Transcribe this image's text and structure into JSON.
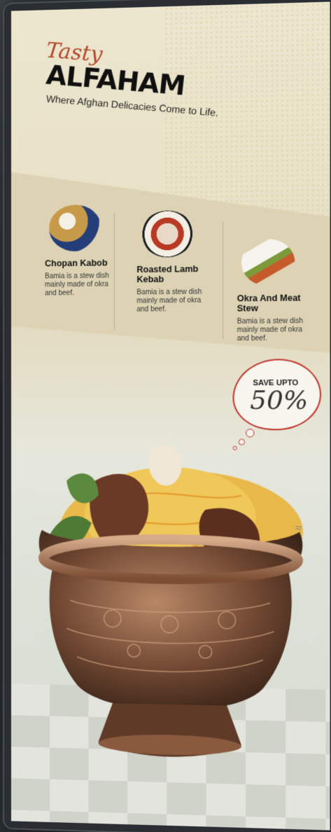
{
  "header": {
    "script": "Tasty",
    "brand": "ALFAHAM",
    "tagline": "Where Afghan Delicacies Come to Life."
  },
  "menu": {
    "items": [
      {
        "name": "Chopan Kabob",
        "description": "Bamia is a stew dish mainly made of okra and beef.",
        "icon": "kabob-plate-icon"
      },
      {
        "name": "Roasted Lamb Kebab",
        "description": "Bamia is a stew dish mainly made of okra and beef.",
        "icon": "lamb-kebab-plate-icon"
      },
      {
        "name": "Okra And Meat Stew",
        "description": "Bamia is a stew dish mainly made of okra and beef.",
        "icon": "stew-trays-icon"
      }
    ]
  },
  "promo": {
    "label": "SAVE UPTO",
    "value": "50%"
  },
  "colors": {
    "accent": "#b24a2a",
    "badge_border": "#c23a32",
    "band": "#ddd3b4",
    "frame": "#2a2e33"
  },
  "hero": {
    "icon": "biryani-pot-icon"
  }
}
